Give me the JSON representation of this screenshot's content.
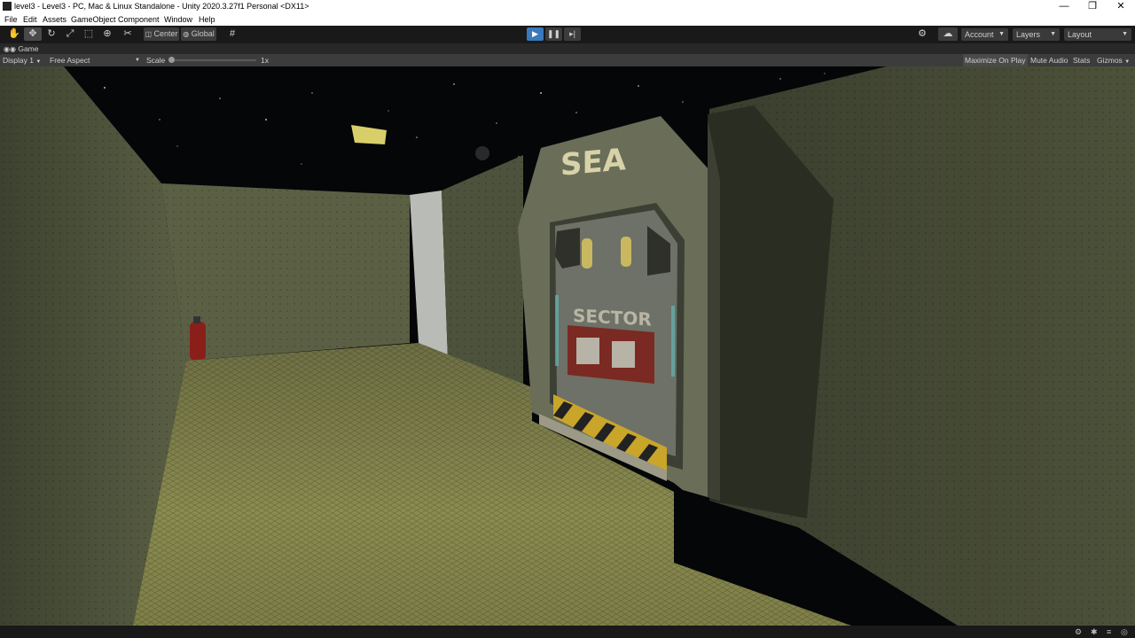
{
  "window": {
    "title": "level3 - Level3 - PC, Mac & Linux Standalone - Unity 2020.3.27f1 Personal <DX11>",
    "controls": {
      "minimize": "—",
      "maximize": "❐",
      "close": "✕"
    }
  },
  "menu": {
    "items": [
      "File",
      "Edit",
      "Assets",
      "GameObject",
      "Component",
      "Window",
      "Help"
    ]
  },
  "toolbar": {
    "pivot_label": "Center",
    "space_label": "Global",
    "account_label": "Account",
    "layers_label": "Layers",
    "layout_label": "Layout"
  },
  "game_view": {
    "tab_label": "Game",
    "display_label": "Display 1",
    "aspect_label": "Free Aspect",
    "scale_label": "Scale",
    "scale_value": "1x",
    "maximize_label": "Maximize On Play",
    "mute_label": "Mute Audio",
    "stats_label": "Stats",
    "gizmos_label": "Gizmos"
  },
  "scene": {
    "door_sign": "SEA",
    "door_label": "SECTOR"
  },
  "colors": {
    "editor_bg": "#191919",
    "toolbar_button": "#3c3c3c",
    "play_active": "#3a79bb",
    "wall": "#4a4f3a",
    "floor": "#7d7f4a"
  }
}
